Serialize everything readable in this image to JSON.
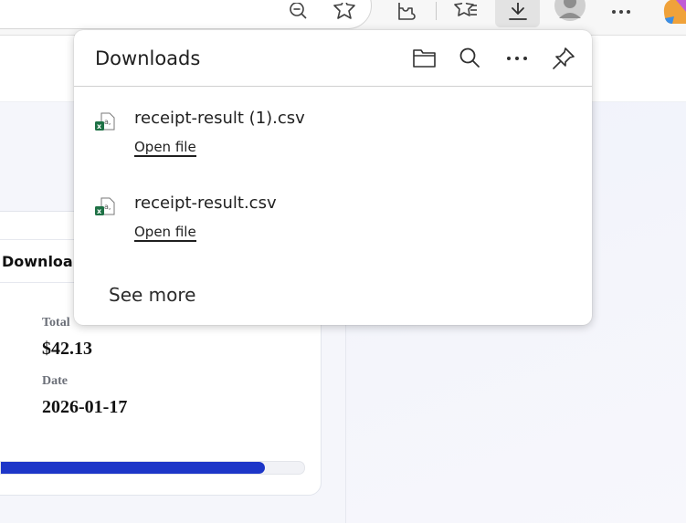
{
  "toolbar": {
    "icons": [
      "zoom-out-icon",
      "favorite-star-icon",
      "extensions-icon",
      "favorites-icon",
      "downloads-icon",
      "profile-avatar",
      "more-icon",
      "copilot-icon"
    ]
  },
  "page": {
    "tab_label": "Downloa",
    "total_label": "Total",
    "total_value": "$42.13",
    "date_label": "Date",
    "date_value": "2026-01-17",
    "progress_fraction": 0.87
  },
  "downloads": {
    "title": "Downloads",
    "actions": [
      "open-folder-icon",
      "search-icon",
      "more-icon",
      "pin-icon"
    ],
    "items": [
      {
        "file_name": "receipt-result (1).csv",
        "action_label": "Open file"
      },
      {
        "file_name": "receipt-result.csv",
        "action_label": "Open file"
      }
    ],
    "see_more": "See more"
  },
  "colors": {
    "accent": "#1d36c8",
    "excel_green": "#1e7145"
  }
}
